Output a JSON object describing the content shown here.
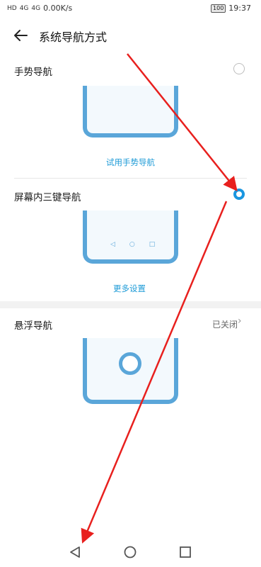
{
  "status_bar": {
    "left_text": "0.00K/s",
    "signal_labels": [
      "HD",
      "4G",
      "4G"
    ],
    "battery": "100",
    "time": "19:37"
  },
  "header": {
    "title": "系统导航方式"
  },
  "gesture": {
    "label": "手势导航",
    "link": "试用手势导航",
    "selected": false
  },
  "three_key": {
    "label": "屏幕内三键导航",
    "link": "更多设置",
    "selected": true
  },
  "floating": {
    "label": "悬浮导航",
    "status": "已关闭"
  },
  "icons": {
    "back": "arrow-left-icon",
    "nav_back": "triangle-back-icon",
    "nav_home": "circle-home-icon",
    "nav_recent": "square-recent-icon"
  },
  "colors": {
    "accent": "#1996e0",
    "phone_frame": "#5aa6d9",
    "annotation_arrow": "#e8201e"
  }
}
